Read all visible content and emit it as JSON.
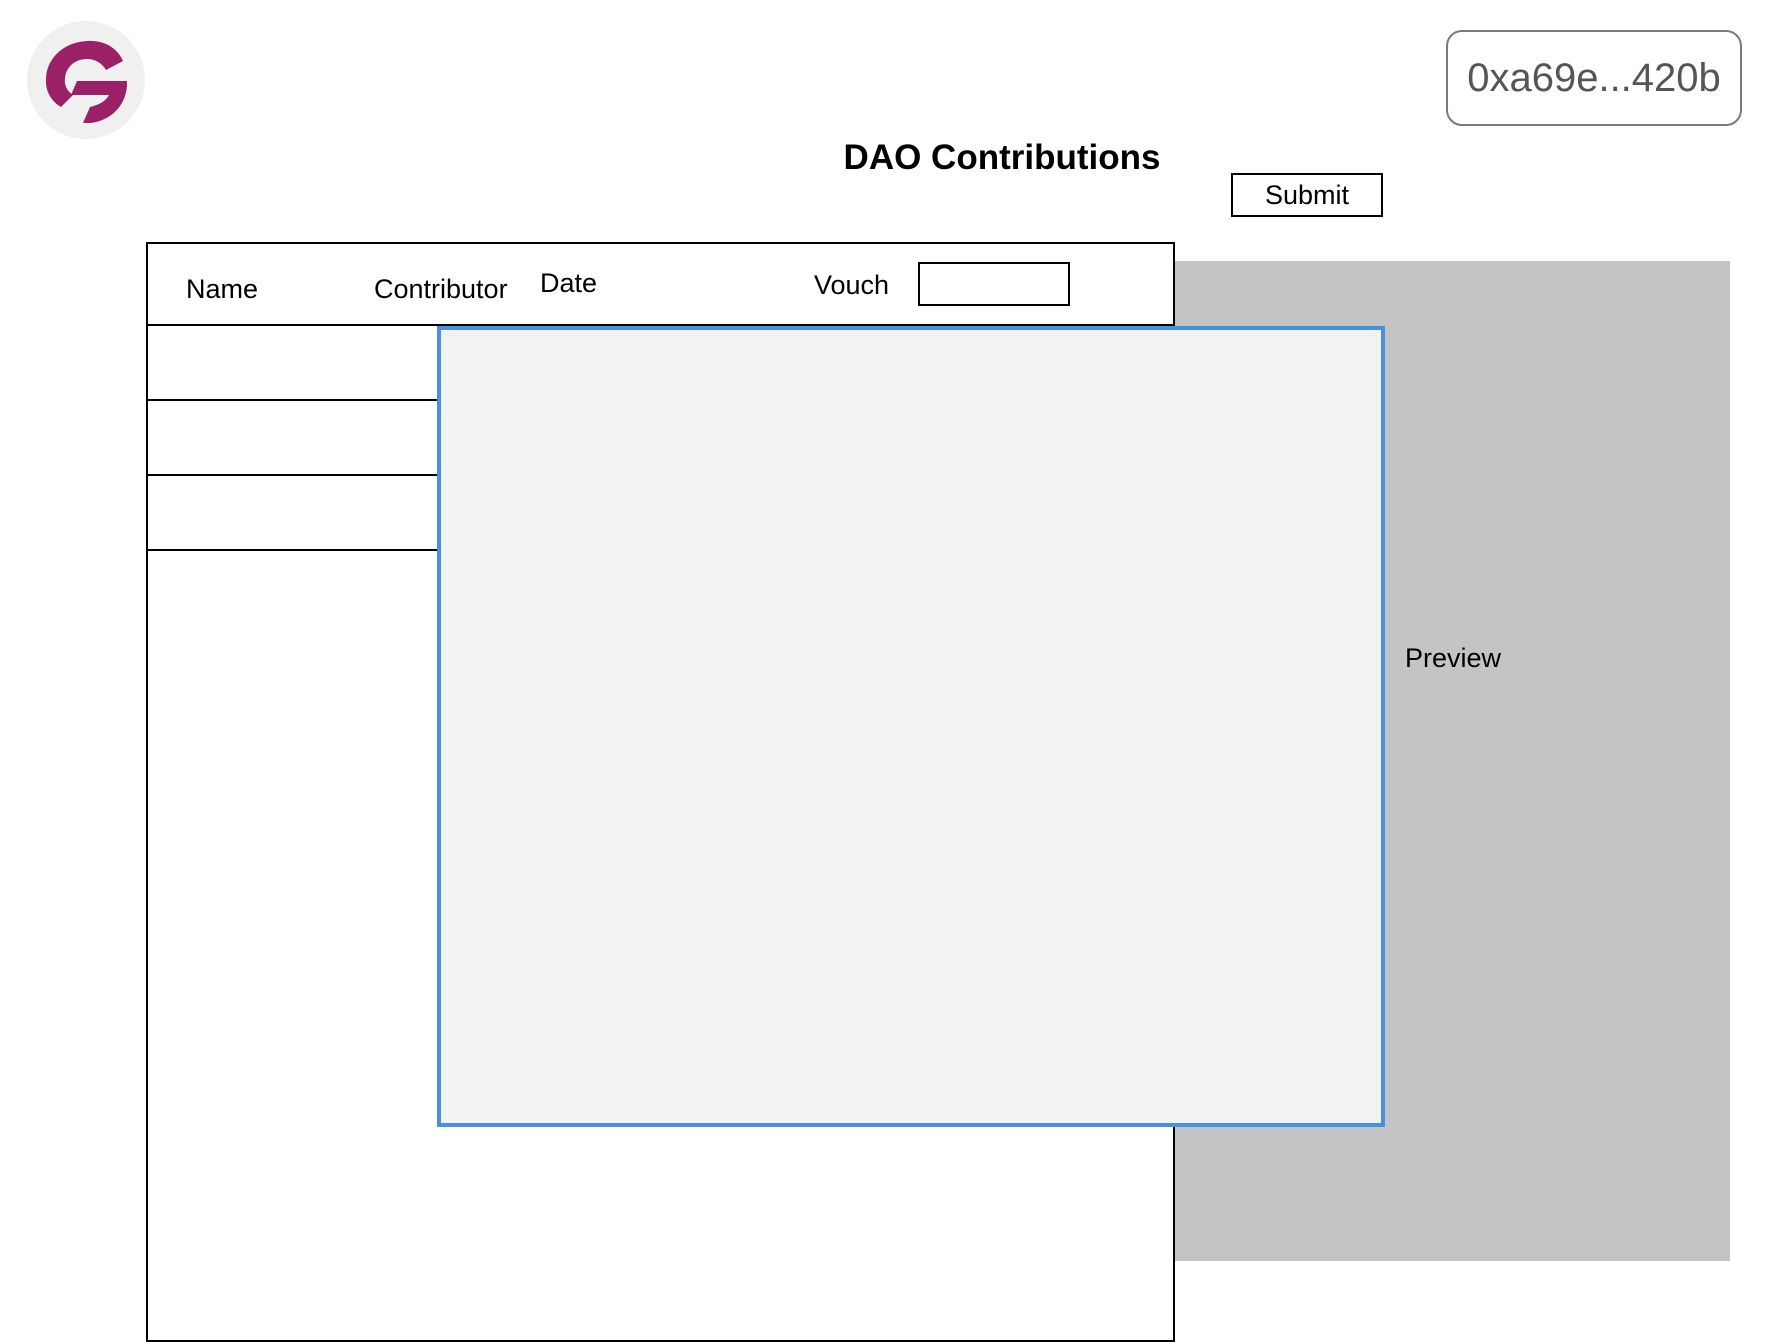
{
  "header": {
    "logo_icon": "gitcoin-logo-icon",
    "brand_color": "#9b2167",
    "wallet_address": "0xa69e...420b"
  },
  "page": {
    "title": "DAO Contributions",
    "submit_label": "Submit"
  },
  "table": {
    "columns": [
      "Name",
      "Contributor",
      "Date",
      "Vouch"
    ],
    "vouch_input_value": "",
    "rows": [
      {},
      {},
      {}
    ]
  },
  "preview": {
    "label": "Preview",
    "panel_color": "#c4c4c4"
  },
  "drop_zone": {
    "border_color": "#4a90e2",
    "fill_color": "#f2f2f2"
  }
}
